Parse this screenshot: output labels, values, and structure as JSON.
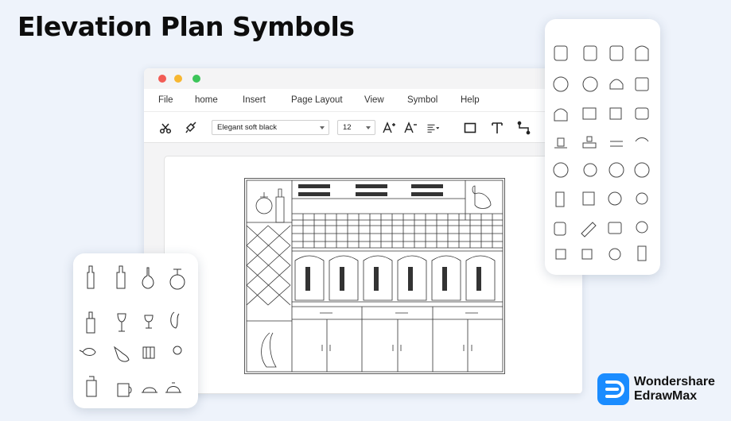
{
  "page": {
    "title": "Elevation Plan Symbols"
  },
  "window": {
    "menu": [
      "File",
      "home",
      "Insert",
      "Page Layout",
      "View",
      "Symbol",
      "Help"
    ],
    "toolbar": {
      "font_value": "Elegant soft black",
      "font_size_value": "12"
    }
  },
  "brand": {
    "line1": "Wondershare",
    "line2": "EdrawMax"
  },
  "colors": {
    "accent": "#1a8cff",
    "red": "#f25c55",
    "yellow": "#f7b731",
    "green": "#3cc55a"
  }
}
